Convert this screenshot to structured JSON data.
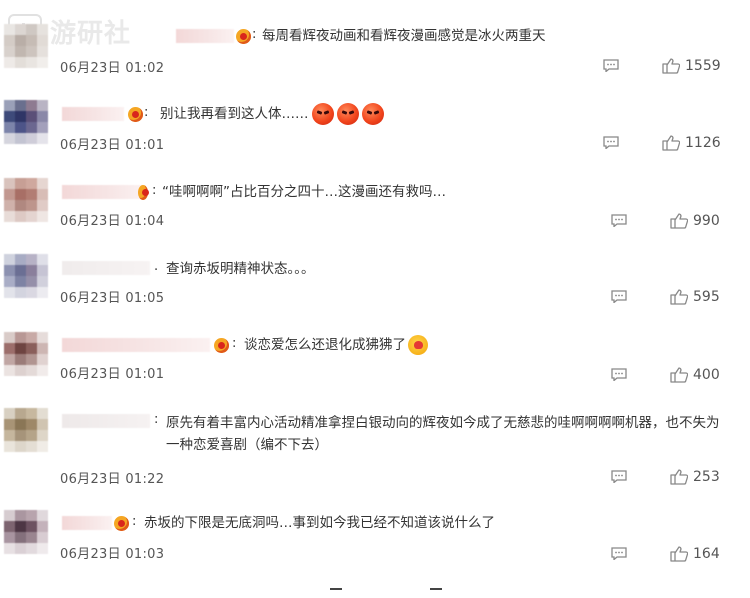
{
  "watermark": {
    "text": "游研社"
  },
  "comments": [
    {
      "text": "每周看辉夜动画和看辉夜漫画感觉是冰火两重天",
      "time": "06月23日 01:02",
      "likes": "1559",
      "emojis": []
    },
    {
      "text": "别让我再看到这人体……",
      "time": "06月23日 01:01",
      "likes": "1126",
      "emojis": [
        "angry-emoji",
        "angry-emoji",
        "angry-emoji"
      ]
    },
    {
      "text": "“哇啊啊啊”占比百分之四十…这漫画还有救吗…",
      "time": "06月23日 01:04",
      "likes": "990",
      "emojis": []
    },
    {
      "text": "查询赤坂明精神状态。。。",
      "time": "06月23日 01:05",
      "likes": "595",
      "emojis": []
    },
    {
      "text": "谈恋爱怎么还退化成狒狒了",
      "time": "06月23日 01:01",
      "likes": "400",
      "emojis": [
        "blush-emoji"
      ]
    },
    {
      "text": "原先有着丰富内心活动精准拿捏白银动向的辉夜如今成了无慈悲的哇啊啊啊啊机器，也不失为一种恋爱喜剧（编不下去）",
      "time": "06月23日 01:22",
      "likes": "253",
      "emojis": []
    },
    {
      "text": "赤坂的下限是无底洞吗…事到如今我已经不知道该说什么了",
      "time": "06月23日 01:03",
      "likes": "164",
      "emojis": []
    }
  ],
  "colors": {
    "text": "#333333",
    "meta": "#555555",
    "badge": "#f5a623",
    "username_blur": "#f3d8d8"
  }
}
